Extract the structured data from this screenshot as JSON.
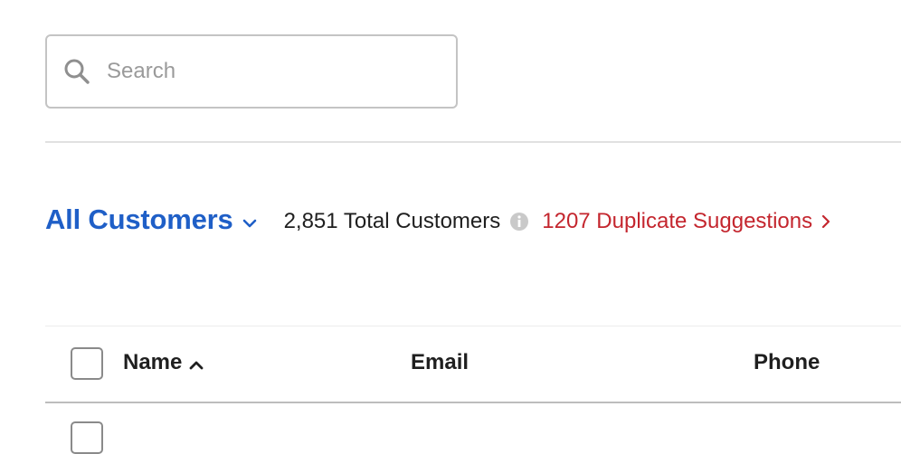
{
  "search": {
    "icon": "search-icon",
    "placeholder": "Search",
    "value": ""
  },
  "summary": {
    "view_label": "All Customers",
    "view_icon": "chevron-down-icon",
    "total_text": "2,851 Total Customers",
    "info_icon": "info-icon",
    "duplicates_text": "1207 Duplicate Suggestions",
    "duplicates_icon": "chevron-right-icon"
  },
  "table": {
    "select_all_checked": false,
    "columns": [
      {
        "label": "Name",
        "sort": "ascending",
        "sort_icon": "chevron-up-icon"
      },
      {
        "label": "Email"
      },
      {
        "label": "Phone"
      }
    ]
  },
  "colors": {
    "accent": "#1f5fc7",
    "alert": "#c4262e",
    "text": "#1f1f1f",
    "placeholder": "#9a9a9a"
  }
}
